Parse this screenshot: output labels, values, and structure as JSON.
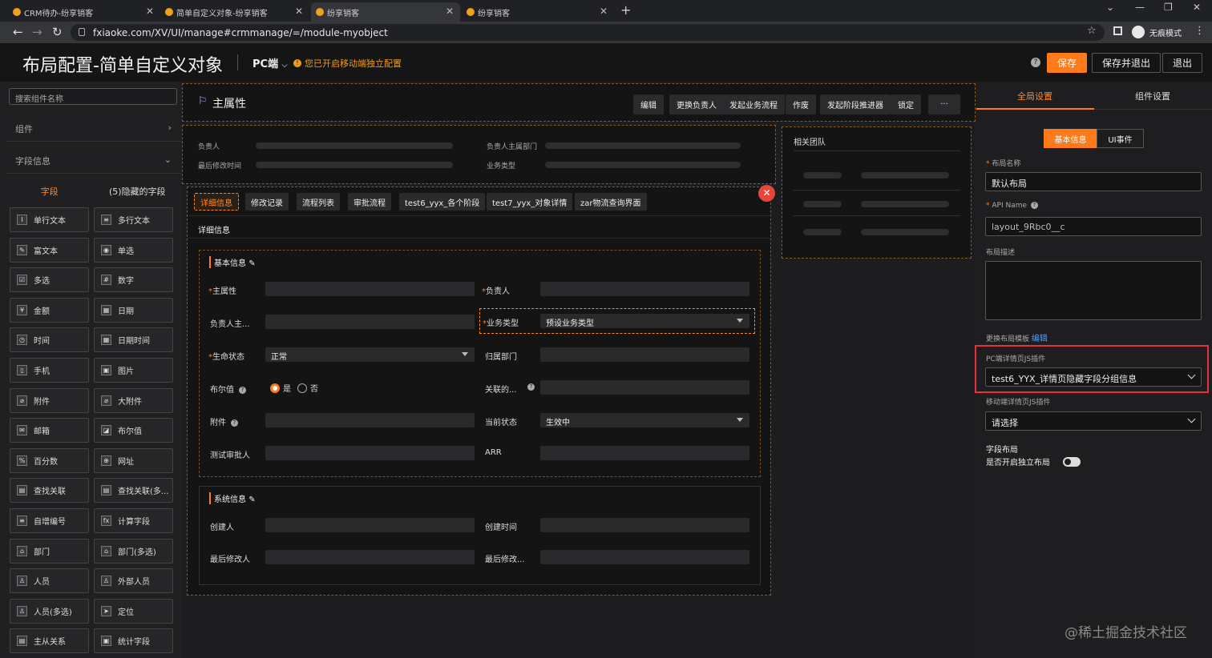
{
  "browser": {
    "tabs": [
      {
        "label": "CRM待办-纷享销客"
      },
      {
        "label": "简单自定义对象-纷享销客"
      },
      {
        "label": "纷享销客"
      },
      {
        "label": "纷享销客"
      }
    ],
    "url": "fxiaoke.com/XV/UI/manage#crmmanage/=/module-myobject",
    "incognito": "无痕模式"
  },
  "header": {
    "title": "布局配置-简单自定义对象",
    "device": "PC端",
    "device_arrow": "⌵",
    "warning": "您已开启移动端独立配置",
    "save": "保存",
    "save_exit": "保存并退出",
    "exit": "退出"
  },
  "left": {
    "search_placeholder": "搜索组件名称",
    "sections": [
      {
        "label": "组件",
        "chev": "›"
      },
      {
        "label": "字段信息",
        "chev": "⌄"
      }
    ],
    "tabs": [
      "字段",
      "(5)隐藏的字段"
    ],
    "fields": [
      {
        "label": "单行文本",
        "icon": "text-icon",
        "glyph": "I"
      },
      {
        "label": "多行文本",
        "icon": "paragraph-icon",
        "glyph": "≡"
      },
      {
        "label": "富文本",
        "icon": "rich-text-icon",
        "glyph": "✎"
      },
      {
        "label": "单选",
        "icon": "radio-icon",
        "glyph": "◉"
      },
      {
        "label": "多选",
        "icon": "checkbox-icon",
        "glyph": "☑"
      },
      {
        "label": "数字",
        "icon": "number-icon",
        "glyph": "#"
      },
      {
        "label": "金额",
        "icon": "currency-icon",
        "glyph": "¥"
      },
      {
        "label": "日期",
        "icon": "date-icon",
        "glyph": "▦"
      },
      {
        "label": "时间",
        "icon": "clock-icon",
        "glyph": "◷"
      },
      {
        "label": "日期时间",
        "icon": "datetime-icon",
        "glyph": "▦"
      },
      {
        "label": "手机",
        "icon": "phone-icon",
        "glyph": "▯"
      },
      {
        "label": "图片",
        "icon": "image-icon",
        "glyph": "▣"
      },
      {
        "label": "附件",
        "icon": "attachment-icon",
        "glyph": "⌀"
      },
      {
        "label": "大附件",
        "icon": "large-attachment-icon",
        "glyph": "⌀"
      },
      {
        "label": "邮箱",
        "icon": "mail-icon",
        "glyph": "✉"
      },
      {
        "label": "布尔值",
        "icon": "boolean-icon",
        "glyph": "◪"
      },
      {
        "label": "百分数",
        "icon": "percent-icon",
        "glyph": "%"
      },
      {
        "label": "网址",
        "icon": "globe-icon",
        "glyph": "⊕"
      },
      {
        "label": "查找关联",
        "icon": "lookup-icon",
        "glyph": "▤"
      },
      {
        "label": "查找关联(多...",
        "icon": "lookup-multi-icon",
        "glyph": "▤"
      },
      {
        "label": "自增编号",
        "icon": "auto-number-icon",
        "glyph": "≡"
      },
      {
        "label": "计算字段",
        "icon": "formula-icon",
        "glyph": "fx"
      },
      {
        "label": "部门",
        "icon": "department-icon",
        "glyph": "⌂"
      },
      {
        "label": "部门(多选)",
        "icon": "department-multi-icon",
        "glyph": "⌂"
      },
      {
        "label": "人员",
        "icon": "person-icon",
        "glyph": "♙"
      },
      {
        "label": "外部人员",
        "icon": "external-person-icon",
        "glyph": "♙"
      },
      {
        "label": "人员(多选)",
        "icon": "person-multi-icon",
        "glyph": "♙"
      },
      {
        "label": "定位",
        "icon": "location-icon",
        "glyph": "➤"
      },
      {
        "label": "主从关系",
        "icon": "master-detail-icon",
        "glyph": "▤"
      },
      {
        "label": "统计字段",
        "icon": "statistics-icon",
        "glyph": "▣"
      }
    ]
  },
  "main": {
    "title": "主属性",
    "actions": [
      "编辑",
      "更换负责人",
      "发起业务流程",
      "作废",
      "发起阶段推进器",
      "锁定",
      "···"
    ],
    "summary_labels": [
      "负责人",
      "负责人主属部门",
      "最后修改时间",
      "业务类型"
    ],
    "team_title": "相关团队",
    "tabs": [
      "详细信息",
      "修改记录",
      "流程列表",
      "审批流程",
      "test6_yyx_各个阶段",
      "test7_yyx_对象详情",
      "zar物流查询界面"
    ],
    "detail_header": "详细信息",
    "basic": {
      "title": "基本信息",
      "f_main": "主属性",
      "f_owner": "负责人",
      "f_owner_dept": "负责人主...",
      "f_biz_type": "业务类型",
      "biz_type_value": "预设业务类型",
      "f_life": "生命状态",
      "life_value": "正常",
      "f_belong_dept": "归属部门",
      "f_bool": "布尔值",
      "yes": "是",
      "no": "否",
      "f_related": "关联的...",
      "f_attach": "附件",
      "f_cur_status": "当前状态",
      "cur_status_value": "生效中",
      "f_test_approver": "测试审批人",
      "f_arr": "ARR",
      "req": "*",
      "q": "?"
    },
    "system": {
      "title": "系统信息",
      "f_creator": "创建人",
      "f_created": "创建时间",
      "f_modifier": "最后修改人",
      "f_modified": "最后修改..."
    }
  },
  "right": {
    "tabs": [
      "全局设置",
      "组件设置"
    ],
    "seg": [
      "基本信息",
      "UI事件"
    ],
    "layout_name_label": "布局名称",
    "layout_name": "默认布局",
    "api_label": "API Name",
    "api_value": "layout_9Rbc0__c",
    "desc_label": "布局描述",
    "template_label": "更换布局模板",
    "template_edit": "编辑",
    "pc_plugin_label": "PC端详情页JS插件",
    "pc_plugin_value": "test6_YYX_详情页隐藏字段分组信息",
    "mobile_plugin_label": "移动端详情页JS插件",
    "mobile_plugin_value": "请选择",
    "field_layout_label": "字段布局",
    "independent_label": "是否开启独立布局"
  },
  "watermark": "@稀土掘金技术社区"
}
